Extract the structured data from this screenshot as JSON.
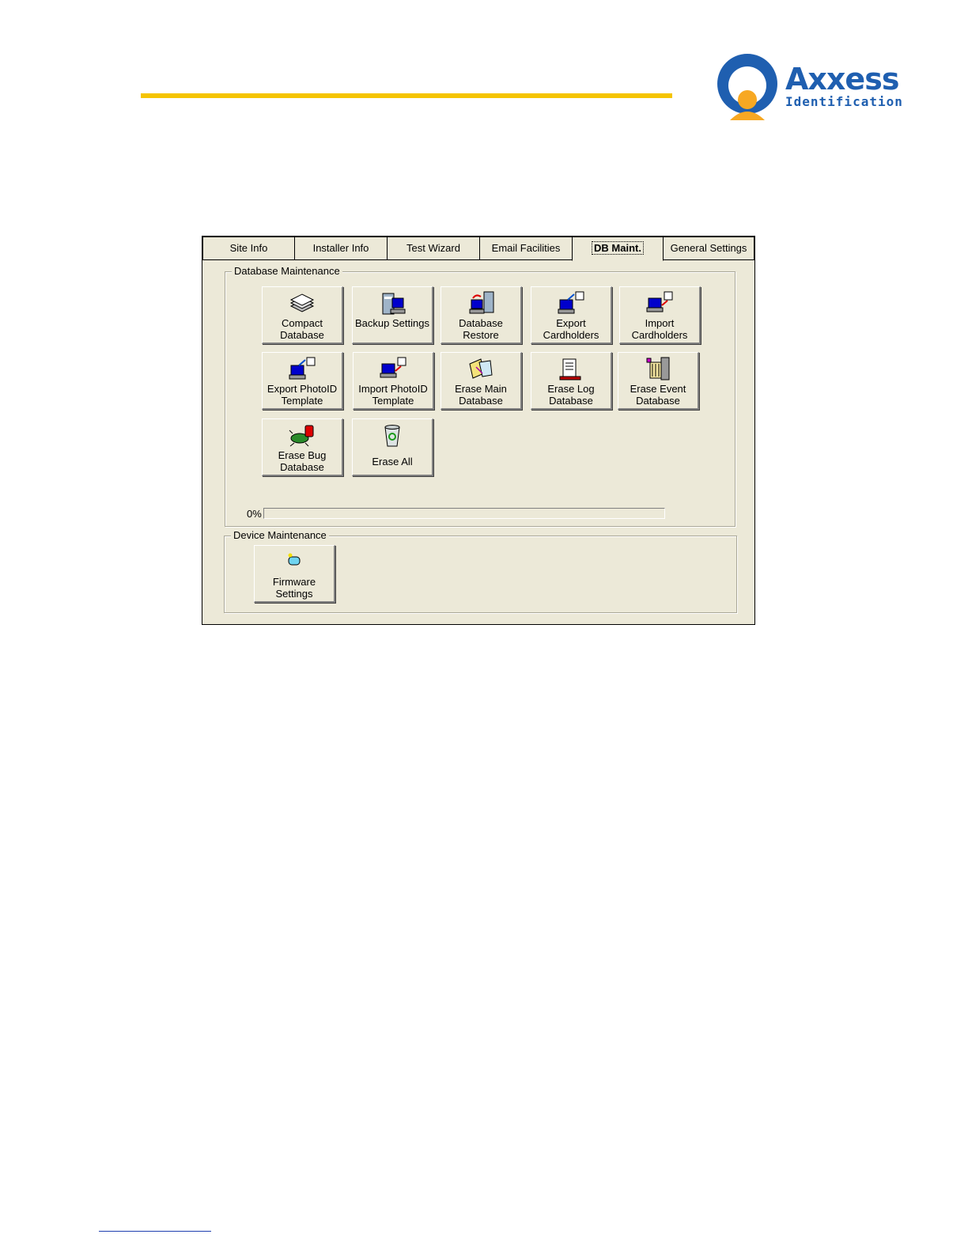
{
  "header": {
    "logo_word": "Axxess",
    "logo_sub": "Identification",
    "brand_color": "#1f5fb0",
    "rule_color": "#f5c400"
  },
  "dialog": {
    "tabs": [
      {
        "label": "Site Info"
      },
      {
        "label": "Installer Info"
      },
      {
        "label": "Test Wizard"
      },
      {
        "label": "Email Facilities"
      },
      {
        "label": "DB Maint.",
        "active": true
      },
      {
        "label": "General Settings"
      }
    ],
    "database_group": {
      "title": "Database Maintenance",
      "buttons": [
        {
          "label": "Compact\nDatabase",
          "icon": "stack-icon"
        },
        {
          "label": "Backup Settings",
          "icon": "server-icon"
        },
        {
          "label": "Database\nRestore",
          "icon": "restore-icon"
        },
        {
          "label": "Export\nCardholders",
          "icon": "export-icon"
        },
        {
          "label": "Import\nCardholders",
          "icon": "import-icon"
        },
        {
          "label": "Export PhotoID\nTemplate",
          "icon": "export-icon"
        },
        {
          "label": "Import PhotoID\nTemplate",
          "icon": "import-icon"
        },
        {
          "label": "Erase Main\nDatabase",
          "icon": "folder-icon"
        },
        {
          "label": "Erase Log\nDatabase",
          "icon": "document-icon"
        },
        {
          "label": "Erase Event\nDatabase",
          "icon": "cabinet-icon"
        },
        {
          "label": "Erase Bug\nDatabase",
          "icon": "bug-icon"
        },
        {
          "label": "Erase All",
          "icon": "recycle-bin-icon"
        }
      ],
      "progress_text": "0%",
      "progress_value": 0
    },
    "device_group": {
      "title": "Device Maintenance",
      "firmware_label": "Firmware\nSettings"
    }
  }
}
